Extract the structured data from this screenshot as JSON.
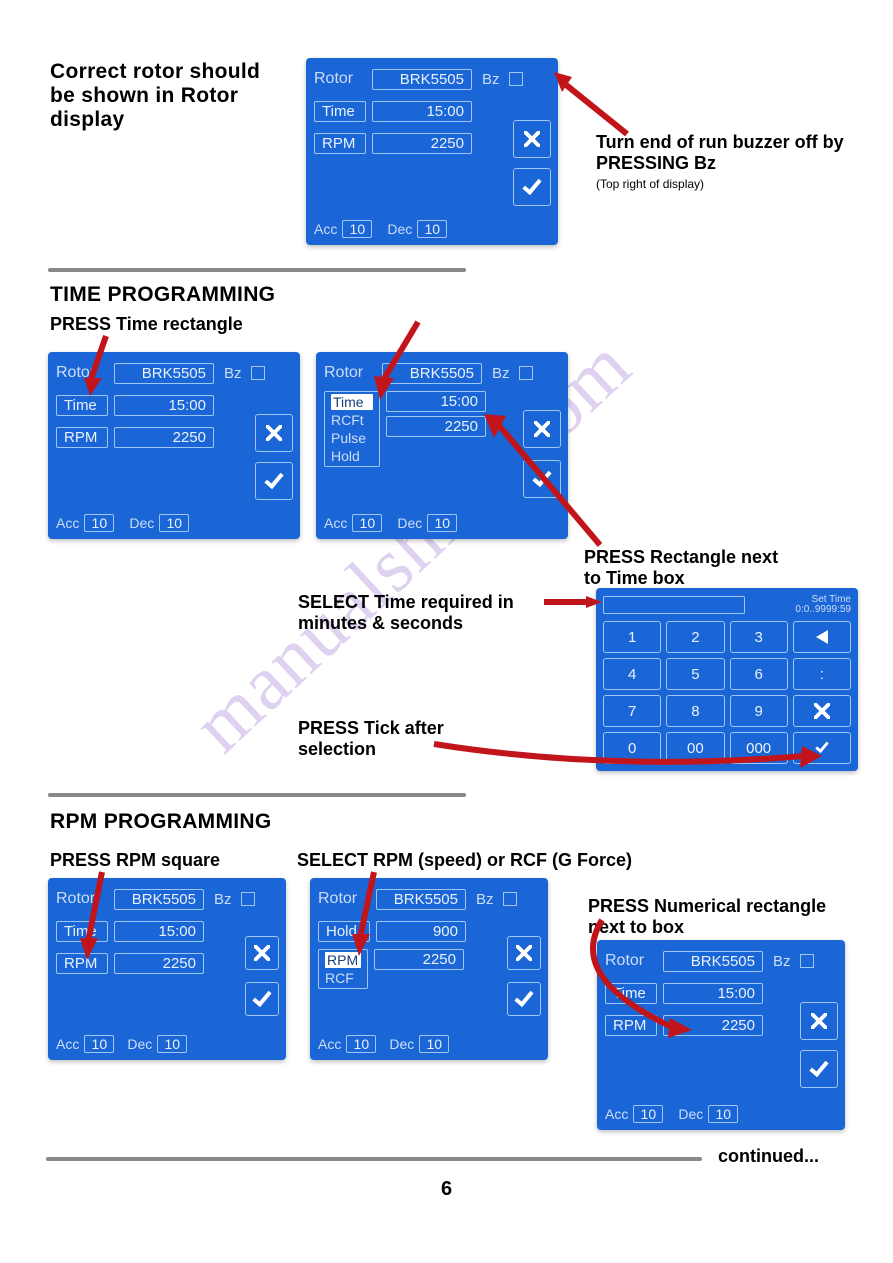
{
  "top": {
    "caption_left": "Correct rotor should be shown in Rotor display",
    "caption_right_1": "Turn end of run buzzer off by PRESSING Bz",
    "caption_right_2": "(Top right of display)"
  },
  "screen_main": {
    "rotor_label": "Rotor",
    "rotor_value": "BRK5505",
    "bz": "Bz",
    "time_label": "Time",
    "time_value": "15:00",
    "rpm_label": "RPM",
    "rpm_value": "2250",
    "acc_label": "Acc",
    "acc_value": "10",
    "dec_label": "Dec",
    "dec_value": "10"
  },
  "section_time": {
    "heading": "TIME PROGRAMMING",
    "sub": "PRESS Time rectangle",
    "caption_dropdown": "PRESS Rectangle next to Time box",
    "caption_keypad_1": "SELECT Time required in minutes & seconds",
    "caption_keypad_2": "PRESS Tick after selection",
    "dropdown": {
      "options": [
        "Time",
        "RCFt",
        "Pulse",
        "Hold"
      ],
      "value": "2250"
    }
  },
  "keypad": {
    "title": "Set Time",
    "range": "0:0..9999:59",
    "keys_row1": [
      "1",
      "2",
      "3"
    ],
    "keys_row2": [
      "4",
      "5",
      "6"
    ],
    "keys_row3": [
      "7",
      "8",
      "9"
    ],
    "keys_row4": [
      "0",
      "00",
      "000"
    ],
    "colon": ":"
  },
  "section_rpm": {
    "heading": "RPM PROGRAMMING",
    "sub_left": "PRESS RPM square",
    "sub_mid": "SELECT RPM (speed) or RCF (G Force)",
    "sub_right": "PRESS Numerical rectangle next to box",
    "screen_mid": {
      "hold_label": "Hold",
      "hold_value": "900",
      "options": [
        "RPM",
        "RCF"
      ]
    }
  },
  "footer": {
    "continued": "continued...",
    "page": "6"
  },
  "watermark": "manualshive.com"
}
